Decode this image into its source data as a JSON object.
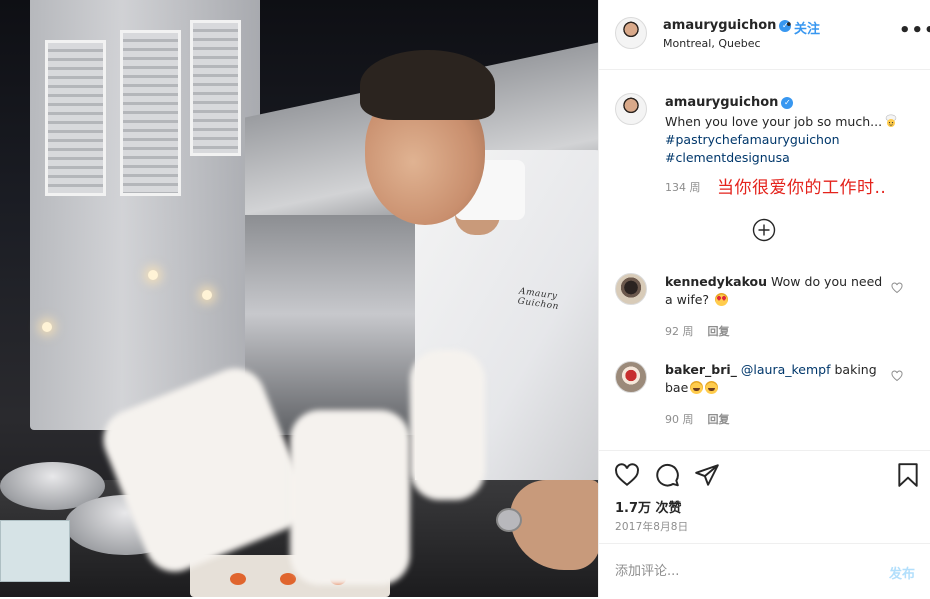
{
  "post": {
    "author": "amauryguichon",
    "verified_mark": "✓",
    "follow_label": "关注",
    "separator": "•",
    "location": "Montreal, Quebec",
    "more_label": "•••",
    "photo_brand_text": "Amaury Guichon"
  },
  "caption": {
    "username": "amauryguichon",
    "text": "When you love your job so much...",
    "emoji": "cook-emoji",
    "hashtags": [
      "#pastrychefamauryguichon",
      "#clementdesignusa"
    ],
    "time": "134 周",
    "overlay_translation": "当你很爱你的工作时..",
    "load_more_icon": "plus-circle-icon"
  },
  "comments": [
    {
      "username": "kennedykakou",
      "text": "Wow do you need a wife?",
      "emoji": "heart-eyes",
      "time": "92 周",
      "reply_label": "回复"
    },
    {
      "username": "baker_bri_",
      "mention": "@laura_kempf",
      "text": "baking bae",
      "emoji": "laughing-tears",
      "time": "90 周",
      "reply_label": "回复"
    }
  ],
  "actions": {
    "icons": [
      "heart-icon",
      "comment-icon",
      "share-icon",
      "bookmark-icon"
    ],
    "likes": "1.7万 次赞",
    "date": "2017年8月8日"
  },
  "add_comment": {
    "placeholder": "添加评论...",
    "post_label": "发布"
  },
  "colors": {
    "link": "#00376b",
    "accent": "#3897f0",
    "overlay_text": "#e4231c",
    "muted": "#8e8e8e"
  }
}
